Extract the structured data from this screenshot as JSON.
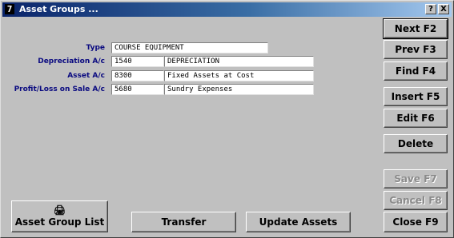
{
  "window": {
    "title": "Asset Groups ...",
    "system_icon": "7",
    "help_button": "?",
    "close_button": "X"
  },
  "form": {
    "type": {
      "label": "Type",
      "value": "COURSE EQUIPMENT"
    },
    "depreciation": {
      "label": "Depreciation A/c",
      "code": "1540",
      "name": "DEPRECIATION"
    },
    "asset": {
      "label": "Asset A/c",
      "code": "8300",
      "name": "Fixed Assets at Cost"
    },
    "profit_loss": {
      "label": "Profit/Loss on Sale A/c",
      "code": "5680",
      "name": "Sundry Expenses"
    }
  },
  "buttons": {
    "next": "Next F2",
    "prev": "Prev F3",
    "find": "Find F4",
    "insert": "Insert F5",
    "edit": "Edit F6",
    "delete": "Delete",
    "save": "Save F7",
    "cancel": "Cancel F8",
    "close": "Close F9",
    "asset_group_list": "Asset Group List",
    "transfer": "Transfer",
    "update_assets": "Update Assets"
  },
  "icons": {
    "printer": "printer-icon"
  }
}
